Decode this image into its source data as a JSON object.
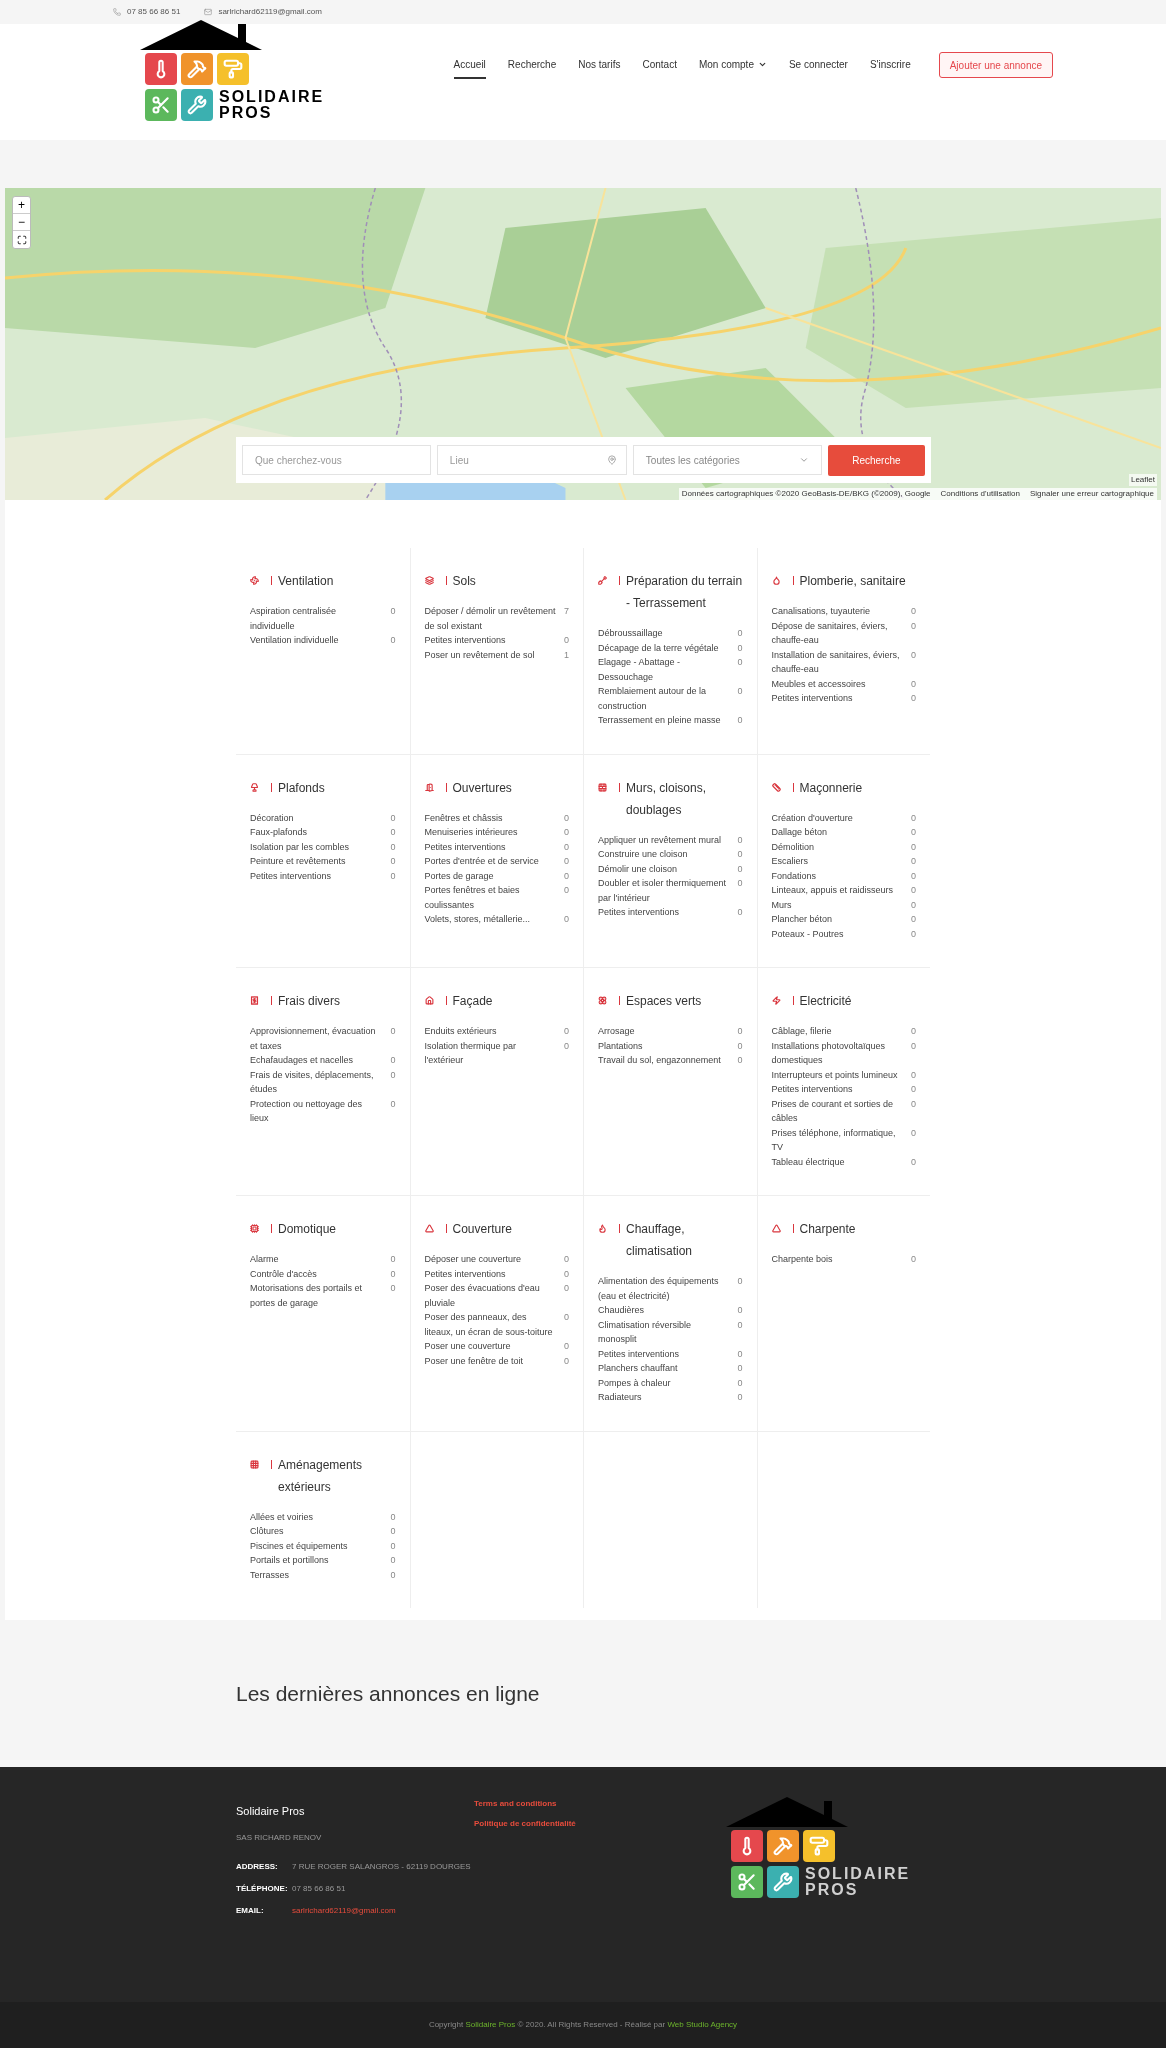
{
  "topbar": {
    "phone": "07 85 66 86 51",
    "email": "sarlrichard62119@gmail.com"
  },
  "logo": {
    "line1": "SOLIDAIRE",
    "line2": "PROS"
  },
  "nav": [
    {
      "label": "Accueil",
      "selected": true,
      "has_menu": false
    },
    {
      "label": "Recherche",
      "selected": false,
      "has_menu": false
    },
    {
      "label": "Nos tarifs",
      "selected": false,
      "has_menu": false
    },
    {
      "label": "Contact",
      "selected": false,
      "has_menu": false
    },
    {
      "label": "Mon compte",
      "selected": false,
      "has_menu": true
    },
    {
      "label": "Se connecter",
      "selected": false,
      "has_menu": false
    },
    {
      "label": "S'inscrire",
      "selected": false,
      "has_menu": false
    }
  ],
  "add_button": "Ajouter une annonce",
  "map": {
    "zoom_in": "+",
    "zoom_out": "−",
    "leaflet": "Leaflet",
    "attribution": [
      "Données cartographiques ©2020 GeoBasis-DE/BKG (©2009), Google",
      "Conditions d'utilisation",
      "Signaler une erreur cartographique"
    ]
  },
  "search": {
    "what_placeholder": "Que cherchez-vous",
    "where_placeholder": "Lieu",
    "category": "Toutes les catégories",
    "button": "Recherche"
  },
  "categories": [
    {
      "title": "Ventilation",
      "items": [
        {
          "label": "Aspiration centralisée individuelle",
          "count": "0"
        },
        {
          "label": "Ventilation individuelle",
          "count": "0"
        }
      ]
    },
    {
      "title": "Sols",
      "items": [
        {
          "label": "Déposer / démolir un revêtement de sol existant",
          "count": "7"
        },
        {
          "label": "Petites interventions",
          "count": "0"
        },
        {
          "label": "Poser un revêtement de sol",
          "count": "1"
        }
      ]
    },
    {
      "title": "Préparation du terrain - Terrassement",
      "items": [
        {
          "label": "Débroussaillage",
          "count": "0"
        },
        {
          "label": "Décapage de la terre végétale",
          "count": "0"
        },
        {
          "label": "Elagage - Abattage - Dessouchage",
          "count": "0"
        },
        {
          "label": "Remblaiement autour de la construction",
          "count": "0"
        },
        {
          "label": "Terrassement en pleine masse",
          "count": "0"
        }
      ]
    },
    {
      "title": "Plomberie, sanitaire",
      "items": [
        {
          "label": "Canalisations, tuyauterie",
          "count": "0"
        },
        {
          "label": "Dépose de sanitaires, éviers, chauffe-eau",
          "count": "0"
        },
        {
          "label": "Installation de sanitaires, éviers, chauffe-eau",
          "count": "0"
        },
        {
          "label": "Meubles et accessoires",
          "count": "0"
        },
        {
          "label": "Petites interventions",
          "count": "0"
        }
      ]
    },
    {
      "title": "Plafonds",
      "items": [
        {
          "label": "Décoration",
          "count": "0"
        },
        {
          "label": "Faux-plafonds",
          "count": "0"
        },
        {
          "label": "Isolation par les combles",
          "count": "0"
        },
        {
          "label": "Peinture et revêtements",
          "count": "0"
        },
        {
          "label": "Petites interventions",
          "count": "0"
        }
      ]
    },
    {
      "title": "Ouvertures",
      "items": [
        {
          "label": "Fenêtres et châssis",
          "count": "0"
        },
        {
          "label": "Menuiseries intérieures",
          "count": "0"
        },
        {
          "label": "Petites interventions",
          "count": "0"
        },
        {
          "label": "Portes d'entrée et de service",
          "count": "0"
        },
        {
          "label": "Portes de garage",
          "count": "0"
        },
        {
          "label": "Portes fenêtres et baies coulissantes",
          "count": "0"
        },
        {
          "label": "Volets, stores, métallerie...",
          "count": "0"
        }
      ]
    },
    {
      "title": "Murs, cloisons, doublages",
      "items": [
        {
          "label": "Appliquer un revêtement mural",
          "count": "0"
        },
        {
          "label": "Construire une cloison",
          "count": "0"
        },
        {
          "label": "Démolir une cloison",
          "count": "0"
        },
        {
          "label": "Doubler et isoler thermiquement par l'intérieur",
          "count": "0"
        },
        {
          "label": "Petites interventions",
          "count": "0"
        }
      ]
    },
    {
      "title": "Maçonnerie",
      "items": [
        {
          "label": "Création d'ouverture",
          "count": "0"
        },
        {
          "label": "Dallage béton",
          "count": "0"
        },
        {
          "label": "Démolition",
          "count": "0"
        },
        {
          "label": "Escaliers",
          "count": "0"
        },
        {
          "label": "Fondations",
          "count": "0"
        },
        {
          "label": "Linteaux, appuis et raidisseurs",
          "count": "0"
        },
        {
          "label": "Murs",
          "count": "0"
        },
        {
          "label": "Plancher béton",
          "count": "0"
        },
        {
          "label": "Poteaux - Poutres",
          "count": "0"
        }
      ]
    },
    {
      "title": "Frais divers",
      "items": [
        {
          "label": "Approvisionnement, évacuation et taxes",
          "count": "0"
        },
        {
          "label": "Echafaudages et nacelles",
          "count": "0"
        },
        {
          "label": "Frais de visites, déplacements, études",
          "count": "0"
        },
        {
          "label": "Protection ou nettoyage des lieux",
          "count": "0"
        }
      ]
    },
    {
      "title": "Façade",
      "items": [
        {
          "label": "Enduits extérieurs",
          "count": "0"
        },
        {
          "label": "Isolation thermique par l'extérieur",
          "count": "0"
        }
      ]
    },
    {
      "title": "Espaces verts",
      "items": [
        {
          "label": "Arrosage",
          "count": "0"
        },
        {
          "label": "Plantations",
          "count": "0"
        },
        {
          "label": "Travail du sol, engazonnement",
          "count": "0"
        }
      ]
    },
    {
      "title": "Electricité",
      "items": [
        {
          "label": "Câblage, filerie",
          "count": "0"
        },
        {
          "label": "Installations photovoltaïques domestiques",
          "count": "0"
        },
        {
          "label": "Interrupteurs et points lumineux",
          "count": "0"
        },
        {
          "label": "Petites interventions",
          "count": "0"
        },
        {
          "label": "Prises de courant et sorties de câbles",
          "count": "0"
        },
        {
          "label": "Prises téléphone, informatique, TV",
          "count": "0"
        },
        {
          "label": "Tableau électrique",
          "count": "0"
        }
      ]
    },
    {
      "title": "Domotique",
      "items": [
        {
          "label": "Alarme",
          "count": "0"
        },
        {
          "label": "Contrôle d'accès",
          "count": "0"
        },
        {
          "label": "Motorisations des portails et portes de garage",
          "count": "0"
        }
      ]
    },
    {
      "title": "Couverture",
      "items": [
        {
          "label": "Déposer une couverture",
          "count": "0"
        },
        {
          "label": "Petites interventions",
          "count": "0"
        },
        {
          "label": "Poser des évacuations d'eau pluviale",
          "count": "0"
        },
        {
          "label": "Poser des panneaux, des liteaux, un écran de sous-toiture",
          "count": "0"
        },
        {
          "label": "Poser une couverture",
          "count": "0"
        },
        {
          "label": "Poser une fenêtre de toit",
          "count": "0"
        }
      ]
    },
    {
      "title": "Chauffage, climatisation",
      "items": [
        {
          "label": "Alimentation des équipements (eau et électricité)",
          "count": "0"
        },
        {
          "label": "Chaudières",
          "count": "0"
        },
        {
          "label": "Climatisation réversible monosplit",
          "count": "0"
        },
        {
          "label": "Petites interventions",
          "count": "0"
        },
        {
          "label": "Planchers chauffant",
          "count": "0"
        },
        {
          "label": "Pompes à chaleur",
          "count": "0"
        },
        {
          "label": "Radiateurs",
          "count": "0"
        }
      ]
    },
    {
      "title": "Charpente",
      "items": [
        {
          "label": "Charpente bois",
          "count": "0"
        }
      ]
    },
    {
      "title": "Aménagements extérieurs",
      "items": [
        {
          "label": "Allées et voiries",
          "count": "0"
        },
        {
          "label": "Clôtures",
          "count": "0"
        },
        {
          "label": "Piscines et équipements",
          "count": "0"
        },
        {
          "label": "Portails et portillons",
          "count": "0"
        },
        {
          "label": "Terrasses",
          "count": "0"
        }
      ]
    }
  ],
  "latest_heading": "Les dernières annonces en ligne",
  "footer": {
    "title": "Solidaire Pros",
    "company": "SAS RICHARD RENOV",
    "details": [
      {
        "label": "ADDRESS:",
        "value": "7 RUE ROGER SALANGROS - 62119 DOURGES",
        "link": false
      },
      {
        "label": "TÉLÉPHONE:",
        "value": "07 85 66 86 51",
        "link": false
      },
      {
        "label": "EMAIL:",
        "value": "sarlrichard62119@gmail.com",
        "link": true
      }
    ],
    "links": [
      "Terms and conditions",
      "Politique de confidentialité"
    ],
    "logo": {
      "line1": "SOLIDAIRE",
      "line2": "PROS"
    }
  },
  "copyright": [
    {
      "text": "Copyright",
      "link": false
    },
    {
      "text": "Solidaire Pros",
      "link": true
    },
    {
      "text": "© 2020. All Rights Reserved - Réalisé par",
      "link": false
    },
    {
      "text": "Web Studio Agency",
      "link": true
    }
  ]
}
